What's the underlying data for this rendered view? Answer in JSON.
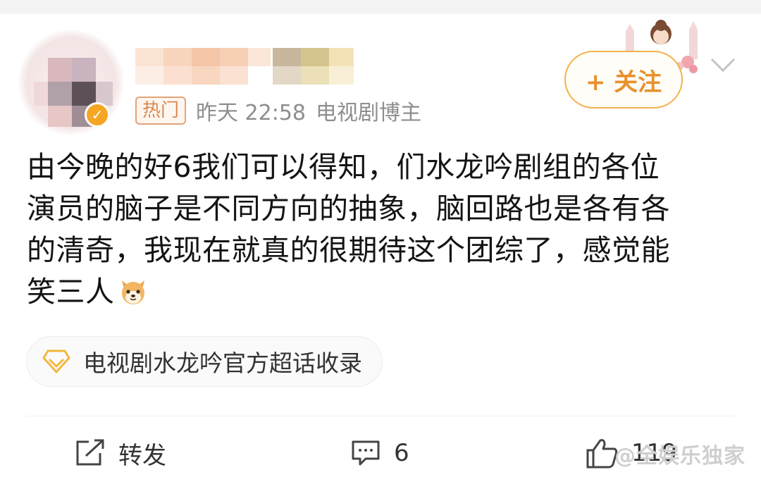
{
  "post": {
    "hot_badge": "热门",
    "time": "昨天 22:58",
    "author_role": "电视剧博主",
    "follow_label": "+ 关注",
    "verified_glyph": "✓",
    "content_lines": [
      "由今晚的好6我们可以得知，们水龙吟剧组的各位",
      "演员的脑子是不同方向的抽象，脑回路也是各有各",
      "的清奇，我现在就真的很期待这个团综了，感觉能",
      "笑三人"
    ],
    "topic_chip": "电视剧水龙吟官方超话收录"
  },
  "actions": {
    "repost_label": "转发",
    "comment_count": "6",
    "like_count": "119"
  },
  "watermark": "@全娱乐独家",
  "colors": {
    "accent": "#f2b24a",
    "follow_text": "#e8912c",
    "muted": "#8e8e8e",
    "badge_border": "#e3a37a"
  },
  "icons": {
    "chevron": "chevron-down-icon",
    "diamond": "diamond-icon",
    "repost": "repost-icon",
    "comment": "comment-icon",
    "like": "thumbs-up-icon",
    "emoji": "dog-emoji-icon"
  }
}
